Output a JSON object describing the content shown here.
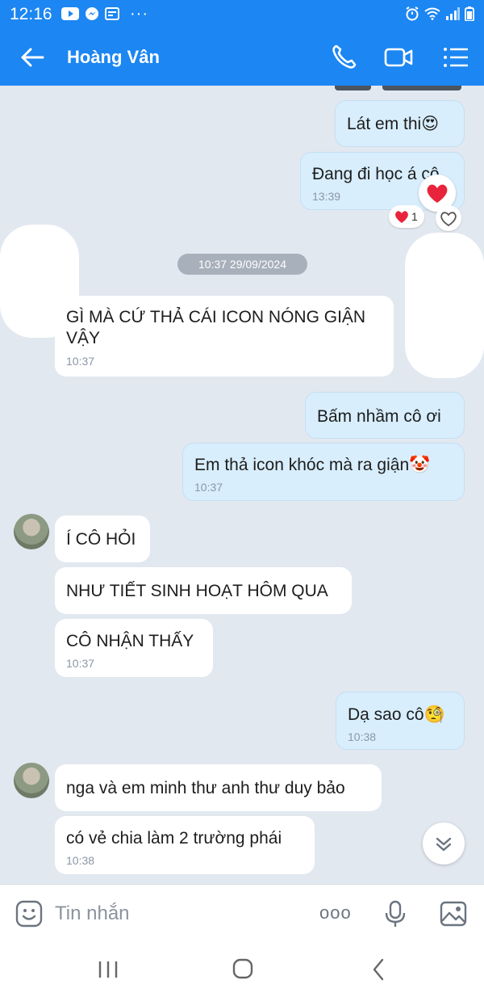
{
  "status_bar": {
    "time": "12:16",
    "left_icons": [
      "youtube-icon",
      "messenger-icon",
      "news-icon"
    ],
    "more": "···",
    "right_icons": [
      "alarm-icon",
      "wifi-icon",
      "signal-icon",
      "battery-icon"
    ]
  },
  "header": {
    "title": "Hoàng Vân",
    "actions": [
      "phone-icon",
      "video-call-icon",
      "menu-icon"
    ],
    "color": "#1c86f2"
  },
  "messages": [
    {
      "from": "me",
      "text": "Lát em thi😍"
    },
    {
      "from": "me",
      "text": "Đang đi học á cô",
      "time": "13:39",
      "reaction": "❤",
      "reaction_count": "1"
    },
    {
      "type": "date",
      "text": "10:37 29/09/2024"
    },
    {
      "from": "them",
      "text": "GÌ MÀ CỨ THẢ CÁI ICON NÓNG GIẬN VẬY",
      "time": "10:37"
    },
    {
      "from": "me",
      "text": "Bấm nhầm cô ơi"
    },
    {
      "from": "me",
      "text": "Em thả icon khóc mà ra giận🤡",
      "time": "10:37"
    },
    {
      "from": "them",
      "text": "Í CÔ HỎI"
    },
    {
      "from": "them",
      "text": "NHƯ TIẾT SINH HOẠT HÔM QUA"
    },
    {
      "from": "them",
      "text": "CÔ NHẬN THẤY",
      "time": "10:37"
    },
    {
      "from": "me",
      "text": "Dạ sao cô🧐",
      "time": "10:38"
    },
    {
      "from": "them",
      "text": "nga và em minh thư anh thư duy bảo"
    },
    {
      "from": "them",
      "text": "có vẻ chia làm 2 trường phái",
      "time": "10:38"
    }
  ],
  "composer": {
    "placeholder": "Tin nhắn",
    "more": "ooo"
  },
  "colors": {
    "chat_bg": "#e2e8f0",
    "outgoing_bubble": "#d8eefd",
    "incoming_bubble": "#ffffff"
  }
}
